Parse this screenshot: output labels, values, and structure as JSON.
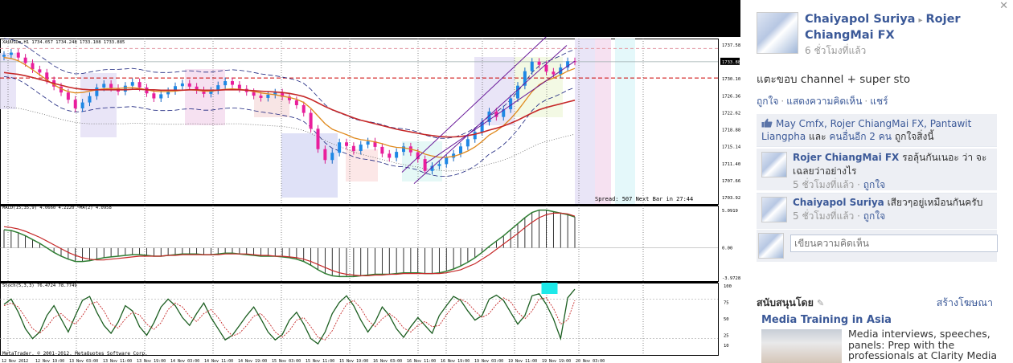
{
  "chart_data": {
    "type": "line",
    "header_text": "XAUUSDm,H1  1734.057 1734.248 1733.108 1733.885",
    "watermark": "MetaTrader, © 2001-2012, MetaQuotes Software Corp.",
    "status_text": "Spread: 507 Next Bar in 27:44",
    "price_axis": [
      "1737.58",
      "1733.885",
      "1730.10",
      "1726.36",
      "1722.62",
      "1718.88",
      "1715.14",
      "1711.40",
      "1707.66",
      "1703.92"
    ],
    "current_price_label": "1733.885",
    "macd_header": "MACD(15,35,9) 4.0660 4.2220 ~MA(2) 4.0958",
    "macd_axis": [
      "5.0919",
      "0.00",
      "-3.9728"
    ],
    "stoch_header": "Stoch(5,3,3) 76.4724 78.7749",
    "stoch_axis": [
      "100",
      "75",
      "50",
      "25",
      "10"
    ],
    "time_axis": [
      "12 Nov 2012",
      "12 Nov 19:00",
      "13 Nov 03:00",
      "13 Nov 11:00",
      "13 Nov 19:00",
      "14 Nov 03:00",
      "14 Nov 11:00",
      "14 Nov 19:00",
      "15 Nov 03:00",
      "15 Nov 11:00",
      "15 Nov 19:00",
      "16 Nov 03:00",
      "16 Nov 11:00",
      "16 Nov 19:00",
      "19 Nov 03:00",
      "19 Nov 11:00",
      "19 Nov 19:00",
      "20 Nov 03:00"
    ],
    "close_prices": [
      1735.4,
      1735.9,
      1734.8,
      1733.6,
      1732.2,
      1731.5,
      1729.8,
      1728.4,
      1727.1,
      1725.5,
      1723.6,
      1724.9,
      1726.3,
      1728.2,
      1729.0,
      1728.1,
      1727.3,
      1728.6,
      1729.4,
      1728.2,
      1726.9,
      1725.8,
      1726.7,
      1727.4,
      1728.5,
      1729.1,
      1728.4,
      1727.6,
      1726.8,
      1727.5,
      1728.7,
      1729.6,
      1728.8,
      1727.9,
      1727.2,
      1726.4,
      1725.9,
      1726.6,
      1727.1,
      1726.2,
      1725.4,
      1724.3,
      1722.6,
      1719.1,
      1714.6,
      1712.2,
      1713.8,
      1716.1,
      1715.3,
      1714.2,
      1715.6,
      1716.3,
      1715.1,
      1713.6,
      1712.7,
      1714.0,
      1715.2,
      1713.9,
      1712.4,
      1709.8,
      1710.9,
      1711.3,
      1712.7,
      1713.6,
      1715.2,
      1716.8,
      1718.4,
      1720.6,
      1722.9,
      1721.7,
      1723.4,
      1725.8,
      1728.6,
      1731.8,
      1733.9,
      1733.2,
      1731.7,
      1731.1,
      1732.6,
      1734.0,
      1733.9
    ],
    "ma_fast": [
      1734.8,
      1734.6,
      1734.1,
      1733.2,
      1732.1,
      1731.0,
      1729.9,
      1728.8,
      1727.9,
      1727.3,
      1727.0,
      1727.1,
      1727.4,
      1727.7,
      1727.9,
      1728.0,
      1728.0,
      1728.1,
      1728.2,
      1728.0,
      1727.7,
      1727.4,
      1727.3,
      1727.3,
      1727.4,
      1727.6,
      1727.7,
      1727.6,
      1727.4,
      1727.4,
      1727.6,
      1727.8,
      1727.9,
      1727.8,
      1727.6,
      1727.3,
      1727.0,
      1726.8,
      1726.6,
      1726.3,
      1726.0,
      1725.6,
      1724.9,
      1723.6,
      1721.9,
      1720.2,
      1719.0,
      1718.4,
      1717.8,
      1717.1,
      1716.7,
      1716.5,
      1716.2,
      1715.8,
      1715.3,
      1715.0,
      1714.9,
      1714.6,
      1714.2,
      1713.5,
      1713.1,
      1712.8,
      1712.8,
      1713.0,
      1713.5,
      1714.2,
      1715.1,
      1716.3,
      1717.7,
      1718.6,
      1719.8,
      1721.3,
      1723.1,
      1725.2,
      1727.3,
      1728.8,
      1729.7,
      1730.3,
      1731.0,
      1731.8,
      1732.4
    ],
    "ma_slow": [
      1731.5,
      1731.3,
      1731.1,
      1730.8,
      1730.4,
      1730.0,
      1729.6,
      1729.1,
      1728.7,
      1728.3,
      1728.0,
      1727.8,
      1727.7,
      1727.7,
      1727.7,
      1727.7,
      1727.7,
      1727.7,
      1727.8,
      1727.8,
      1727.7,
      1727.7,
      1727.6,
      1727.6,
      1727.6,
      1727.6,
      1727.7,
      1727.7,
      1727.6,
      1727.6,
      1727.6,
      1727.7,
      1727.7,
      1727.7,
      1727.6,
      1727.5,
      1727.4,
      1727.3,
      1727.2,
      1727.1,
      1726.9,
      1726.6,
      1726.2,
      1725.6,
      1724.8,
      1724.0,
      1723.3,
      1722.7,
      1722.1,
      1721.5,
      1721.0,
      1720.6,
      1720.2,
      1719.8,
      1719.4,
      1719.0,
      1718.7,
      1718.4,
      1718.1,
      1717.8,
      1717.6,
      1717.4,
      1717.3,
      1717.3,
      1717.4,
      1717.6,
      1717.9,
      1718.3,
      1718.8,
      1719.2,
      1719.7,
      1720.3,
      1721.0,
      1721.8,
      1722.6,
      1723.3,
      1723.8,
      1724.2,
      1724.6,
      1725.0,
      1725.4
    ],
    "macd_values": [
      2.4,
      2.3,
      2.0,
      1.6,
      1.1,
      0.6,
      0.0,
      -0.6,
      -1.1,
      -1.5,
      -1.8,
      -1.8,
      -1.7,
      -1.5,
      -1.3,
      -1.2,
      -1.1,
      -1.0,
      -0.9,
      -0.9,
      -1.0,
      -1.1,
      -1.1,
      -1.0,
      -0.9,
      -0.8,
      -0.8,
      -0.8,
      -0.9,
      -0.9,
      -0.8,
      -0.7,
      -0.7,
      -0.8,
      -0.9,
      -1.0,
      -1.1,
      -1.1,
      -1.1,
      -1.2,
      -1.3,
      -1.5,
      -1.8,
      -2.3,
      -2.9,
      -3.4,
      -3.7,
      -3.8,
      -3.8,
      -3.8,
      -3.7,
      -3.6,
      -3.5,
      -3.5,
      -3.5,
      -3.4,
      -3.3,
      -3.3,
      -3.3,
      -3.4,
      -3.4,
      -3.3,
      -3.1,
      -2.8,
      -2.4,
      -1.9,
      -1.3,
      -0.6,
      0.2,
      0.9,
      1.6,
      2.4,
      3.2,
      4.0,
      4.7,
      5.0,
      5.0,
      4.8,
      4.6,
      4.4,
      4.1
    ],
    "macd_signal": [
      2.8,
      2.7,
      2.5,
      2.2,
      1.8,
      1.4,
      0.9,
      0.4,
      -0.1,
      -0.6,
      -1.0,
      -1.3,
      -1.5,
      -1.6,
      -1.6,
      -1.5,
      -1.4,
      -1.3,
      -1.2,
      -1.1,
      -1.1,
      -1.1,
      -1.1,
      -1.0,
      -1.0,
      -0.9,
      -0.9,
      -0.9,
      -0.9,
      -0.9,
      -0.9,
      -0.8,
      -0.8,
      -0.8,
      -0.8,
      -0.9,
      -1.0,
      -1.0,
      -1.1,
      -1.1,
      -1.2,
      -1.3,
      -1.5,
      -1.8,
      -2.2,
      -2.6,
      -3.0,
      -3.3,
      -3.5,
      -3.6,
      -3.7,
      -3.7,
      -3.6,
      -3.6,
      -3.5,
      -3.5,
      -3.4,
      -3.4,
      -3.4,
      -3.4,
      -3.4,
      -3.4,
      -3.3,
      -3.1,
      -2.9,
      -2.5,
      -2.1,
      -1.5,
      -0.9,
      -0.2,
      0.5,
      1.2,
      1.9,
      2.7,
      3.4,
      4.0,
      4.4,
      4.6,
      4.6,
      4.5,
      4.2
    ],
    "stoch_k": [
      72,
      80,
      60,
      35,
      20,
      30,
      55,
      70,
      50,
      30,
      55,
      78,
      84,
      60,
      40,
      28,
      45,
      70,
      62,
      38,
      25,
      44,
      68,
      80,
      70,
      52,
      40,
      58,
      74,
      52,
      35,
      18,
      25,
      40,
      55,
      68,
      50,
      30,
      18,
      26,
      48,
      60,
      42,
      20,
      12,
      30,
      58,
      75,
      85,
      70,
      48,
      30,
      45,
      68,
      55,
      35,
      22,
      38,
      52,
      40,
      28,
      55,
      70,
      84,
      78,
      62,
      48,
      55,
      80,
      86,
      78,
      60,
      42,
      55,
      85,
      88,
      72,
      50,
      20,
      82,
      95
    ],
    "stoch_d": [
      70,
      74,
      68,
      52,
      35,
      28,
      38,
      52,
      58,
      48,
      42,
      55,
      72,
      76,
      62,
      42,
      36,
      50,
      60,
      56,
      42,
      34,
      44,
      64,
      74,
      68,
      54,
      46,
      58,
      64,
      52,
      36,
      24,
      28,
      40,
      54,
      58,
      46,
      30,
      22,
      32,
      48,
      52,
      38,
      22,
      18,
      32,
      54,
      72,
      78,
      66,
      48,
      38,
      50,
      58,
      50,
      36,
      30,
      40,
      46,
      38,
      40,
      56,
      70,
      80,
      74,
      62,
      52,
      58,
      72,
      82,
      76,
      60,
      50,
      62,
      80,
      82,
      66,
      42,
      48,
      78
    ],
    "y_range": [
      1702.5,
      1739.0
    ],
    "macd_range": [
      -4.4,
      5.6
    ],
    "stoch_range": [
      0,
      100
    ]
  },
  "facebook": {
    "close_label": "✕",
    "author": "Chaiyapol Suriya",
    "arrow": "▸",
    "target": "Rojer ChiangMai FX",
    "time": "6 ชั่วโมงที่แล้ว",
    "post_text": "แตะขอบ channel + super sto",
    "actions": [
      "ถูกใจ",
      "แสดงความคิดเห็น",
      "แชร์"
    ],
    "likes_names": "May Cmfx, Rojer ChiangMai FX, Pantawit Liangpha",
    "likes_suffix": "และ",
    "likes_others": "คนอื่นอีก 2 คน",
    "likes_end": "ถูกใจสิ่งนี้",
    "comments": [
      {
        "name": "Rojer ChiangMai FX",
        "text": "รอลุ้นกันเนอะ ว่า จะเฉลยว่าอย่างไร",
        "time": "5 ชั่วโมงที่แล้ว",
        "like": "ถูกใจ"
      },
      {
        "name": "Chaiyapol Suriya",
        "text": "เสียวๆอยู่เหมือนกันครับ",
        "time": "5 ชั่วโมงที่แล้ว",
        "like": "ถูกใจ"
      }
    ],
    "comment_placeholder": "เขียนความคิดเห็น",
    "sponsored_title": "สนับสนุนโดย",
    "create_ad": "สร้างโฆษณา",
    "ad_title": "Media Training in Asia",
    "ad_text": "Media interviews, speeches, panels: Prep with the professionals at Clarity Media"
  }
}
